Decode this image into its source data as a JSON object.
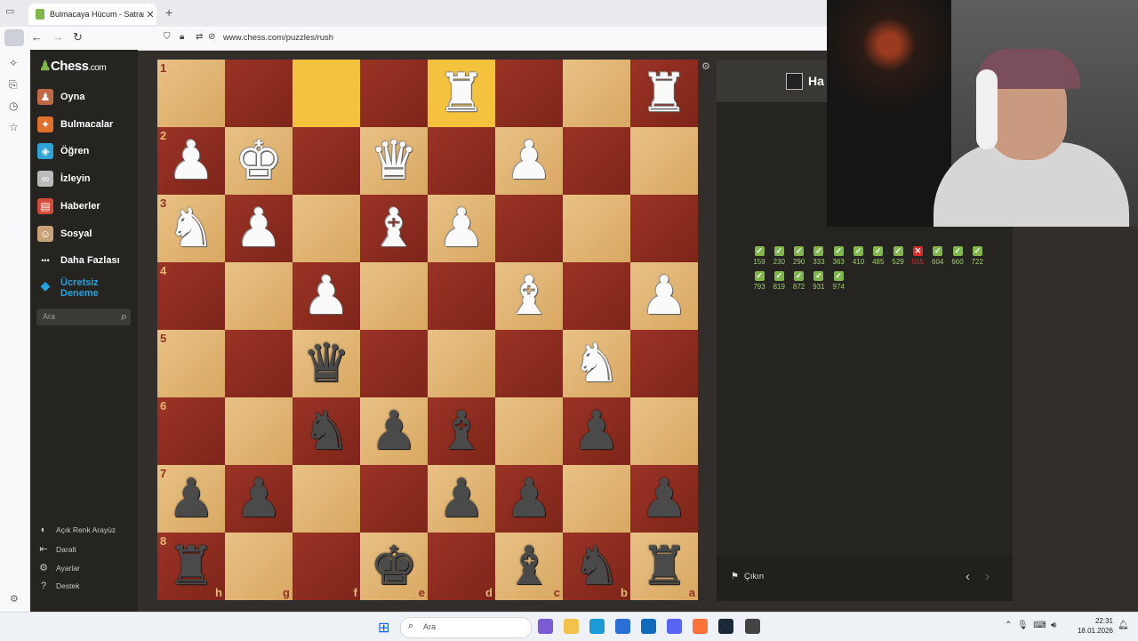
{
  "browser": {
    "tab_title": "Bulmacaya Hücum - Satranç Bu",
    "url": "www.chess.com/puzzles/rush"
  },
  "nav": {
    "logo": "Chess",
    "logo_suffix": ".com",
    "items": [
      {
        "label": "Oyna",
        "icon": "play-icon",
        "color": "#c26a48"
      },
      {
        "label": "Bulmacalar",
        "icon": "puzzle-icon",
        "color": "#e0712d"
      },
      {
        "label": "Öğren",
        "icon": "learn-icon",
        "color": "#2fa3d9"
      },
      {
        "label": "İzleyin",
        "icon": "binoculars-icon",
        "color": "#bbbbbb"
      },
      {
        "label": "Haberler",
        "icon": "news-icon",
        "color": "#d24a3a"
      },
      {
        "label": "Sosyal",
        "icon": "social-icon",
        "color": "#c9a27a"
      },
      {
        "label": "Daha Fazlası",
        "icon": "more-icon",
        "color": "#cccccc"
      }
    ],
    "trial_line1": "Ücretsiz",
    "trial_line2": "Deneme",
    "search_placeholder": "Ara",
    "bottom": [
      {
        "label": "Açık Renk Arayüz",
        "icon": "theme-icon"
      },
      {
        "label": "Daralt",
        "icon": "collapse-icon"
      },
      {
        "label": "Ayarlar",
        "icon": "settings-icon"
      },
      {
        "label": "Destek",
        "icon": "help-icon"
      }
    ]
  },
  "board": {
    "ranks": [
      "1",
      "2",
      "3",
      "4",
      "5",
      "6",
      "7",
      "8"
    ],
    "files": [
      "h",
      "g",
      "f",
      "e",
      "d",
      "c",
      "b",
      "a"
    ],
    "highlight": [
      "0-2",
      "0-4"
    ],
    "rows": [
      [
        null,
        null,
        null,
        null,
        "wR",
        null,
        null,
        "wR"
      ],
      [
        "wP",
        "wK",
        null,
        "wQ",
        null,
        "wP",
        null,
        null
      ],
      [
        "wN",
        "wP",
        null,
        "wB",
        "wP",
        null,
        null,
        null
      ],
      [
        null,
        null,
        "wP",
        null,
        null,
        "wB",
        null,
        "wP"
      ],
      [
        null,
        null,
        "bQ",
        null,
        null,
        null,
        "wN",
        null
      ],
      [
        null,
        null,
        "bN",
        "bP",
        "bB",
        null,
        "bP",
        null
      ],
      [
        "bP",
        "bP",
        null,
        null,
        "bP",
        "bP",
        null,
        "bP"
      ],
      [
        "bR",
        null,
        null,
        "bK",
        null,
        "bB",
        "bN",
        "bR"
      ]
    ]
  },
  "panel": {
    "header_text": "Ha",
    "scores": [
      {
        "value": "159",
        "ok": true
      },
      {
        "value": "230",
        "ok": true
      },
      {
        "value": "290",
        "ok": true
      },
      {
        "value": "333",
        "ok": true
      },
      {
        "value": "363",
        "ok": true
      },
      {
        "value": "410",
        "ok": true
      },
      {
        "value": "485",
        "ok": true
      },
      {
        "value": "529",
        "ok": true
      },
      {
        "value": "555",
        "ok": false
      },
      {
        "value": "604",
        "ok": true
      },
      {
        "value": "660",
        "ok": true
      },
      {
        "value": "722",
        "ok": true
      },
      {
        "value": "793",
        "ok": true
      },
      {
        "value": "819",
        "ok": true
      },
      {
        "value": "872",
        "ok": true
      },
      {
        "value": "931",
        "ok": true
      },
      {
        "value": "974",
        "ok": true
      }
    ],
    "quit_label": "Çıkın"
  },
  "taskbar": {
    "search_placeholder": "Ara",
    "time": "22:31",
    "date": "18.01.2026",
    "apps": [
      {
        "name": "copilot-app-icon",
        "color": "#7b5cd6"
      },
      {
        "name": "file-explorer-icon",
        "color": "#f2c24b"
      },
      {
        "name": "edge-icon",
        "color": "#1a9bd7"
      },
      {
        "name": "store-icon",
        "color": "#2b6fd6"
      },
      {
        "name": "outlook-icon",
        "color": "#0f6cbd"
      },
      {
        "name": "discord-icon",
        "color": "#5865f2"
      },
      {
        "name": "firefox-icon",
        "color": "#ff7139"
      },
      {
        "name": "steam-icon",
        "color": "#1b2838"
      },
      {
        "name": "chess-app-icon",
        "color": "#444444"
      }
    ]
  }
}
